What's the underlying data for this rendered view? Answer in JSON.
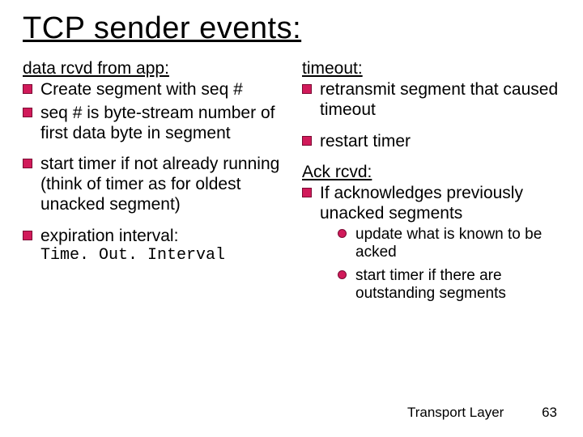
{
  "title": "TCP sender events:",
  "left": {
    "heading": "data rcvd from app:",
    "items": [
      "Create segment with seq #",
      "seq # is byte-stream number of first data byte in  segment",
      "start timer if not already running (think of timer as for oldest unacked segment)",
      "expiration interval:"
    ],
    "expiration_code": "Time. Out. Interval"
  },
  "right": {
    "timeout_heading": "timeout:",
    "timeout_items": [
      "retransmit segment that caused timeout",
      "restart timer"
    ],
    "ack_heading": " Ack rcvd:",
    "ack_item": "If acknowledges previously unacked segments",
    "ack_subitems": [
      "update what is known to be acked",
      "start timer if there are outstanding segments"
    ]
  },
  "footer": {
    "label": "Transport Layer",
    "page": "63"
  }
}
